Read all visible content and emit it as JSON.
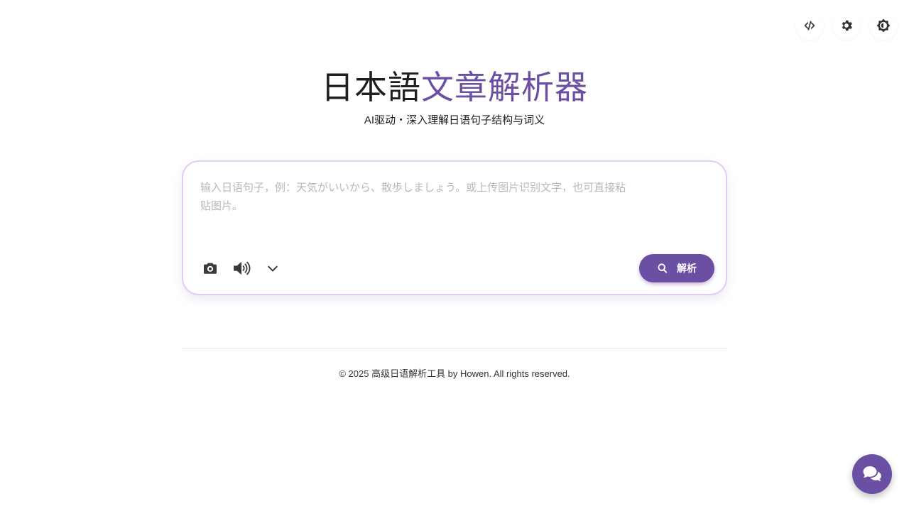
{
  "header": {
    "title_part1": "日本語",
    "title_part2": "文章解析器",
    "subtitle": "AI驱动・深入理解日语句子结构与词义"
  },
  "top_actions": [
    {
      "icon": "code-icon"
    },
    {
      "icon": "gear-icon"
    },
    {
      "icon": "theme-toggle-icon"
    }
  ],
  "input": {
    "placeholder": "输入日语句子，例：天気がいいから、散歩しましょう。或上传图片识别文字，也可直接粘贴图片。",
    "value": ""
  },
  "tools": [
    {
      "icon": "camera-icon"
    },
    {
      "icon": "volume-icon"
    },
    {
      "icon": "chevron-down-icon"
    }
  ],
  "analyze_button": {
    "label": "解析",
    "icon": "search-icon"
  },
  "footer": {
    "text": "© 2025 高级日语解析工具 by Howen. All rights reserved."
  },
  "colors": {
    "accent": "#6a4fa3",
    "card_border": "#e3ccf5"
  }
}
